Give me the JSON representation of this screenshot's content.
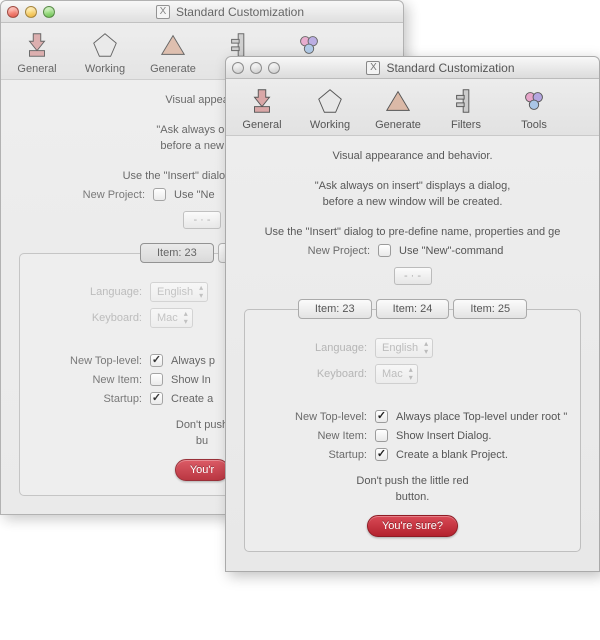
{
  "window_title": "Standard Customization",
  "toolbar": {
    "general": "General",
    "working": "Working",
    "generate": "Generate",
    "filters": "Filters",
    "tools": "Tools"
  },
  "intro": {
    "line1": "Visual appearance and behavior.",
    "line2a": "\"Ask always on insert\" displays a dialog,",
    "line2b": "before a new window will be created.",
    "line3": "Use the \"Insert\" dialog to pre-define name, properties and ge"
  },
  "intro_short": {
    "line1": "Visual appeara",
    "line2a": "\"Ask always on ins",
    "line2b": "before a new win",
    "line3": "Use the \"Insert\" dialog to pre-def"
  },
  "form": {
    "new_project_label": "New Project:",
    "new_project_opt": "Use \"New\"-command",
    "new_project_opt_short": "Use \"Ne"
  },
  "tabs": {
    "item23": "Item: 23",
    "item24": "Item: 24",
    "item25": "Item: 25",
    "item_short": "Ite"
  },
  "panel": {
    "language_label": "Language:",
    "language_value": "English",
    "keyboard_label": "Keyboard:",
    "keyboard_value": "Mac",
    "new_toplevel_label": "New Top-level:",
    "new_toplevel_opt": "Always place Top-level under root \"",
    "new_toplevel_opt_short": "Always p",
    "new_item_label": "New Item:",
    "new_item_opt": "Show Insert Dialog.",
    "new_item_opt_short": "Show In",
    "startup_label": "Startup:",
    "startup_opt": "Create a blank Project.",
    "startup_opt_short": "Create a"
  },
  "footer": {
    "hint_line1": "Don't push the little red",
    "hint_line2": "button.",
    "hint_line1_short": "Don't push",
    "hint_line2_short": "bu",
    "button": "You're sure?",
    "button_short": "You'r"
  },
  "title_badge": "X"
}
